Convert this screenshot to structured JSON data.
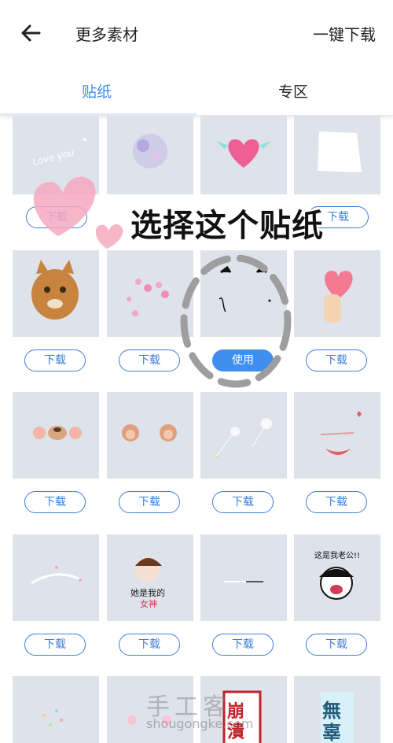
{
  "header": {
    "title": "更多素材",
    "download_all": "一键下载"
  },
  "tabs": [
    {
      "label": "贴纸"
    },
    {
      "label": "专区"
    }
  ],
  "buttons": {
    "download": "下载",
    "use": "使用"
  },
  "stickers": [
    [
      "love-you-text",
      "purple-sparkle",
      "winged-heart",
      "white-paper"
    ],
    [
      "cat-face",
      "pink-hearts",
      "cartoon-face",
      "heart-hand"
    ],
    [
      "bear-blush",
      "bear-ears",
      "dandelion",
      "laughing-mouth"
    ],
    [
      "light-arc",
      "goddess-girl",
      "white-line",
      "meme-guy"
    ],
    [
      "sparkles",
      "pink-glow",
      "collapse-sign",
      "speechless-sign"
    ]
  ],
  "overlay": {
    "instruction": "选择这个贴纸"
  },
  "sticker_text": {
    "love_you": "Love you",
    "goddess": "她是我的\n女神",
    "meme": "这是我老公!!",
    "collapse": "崩潰",
    "speechless": "無辜"
  },
  "watermark": {
    "main": "手工客",
    "sub": "shougongke.com"
  },
  "colors": {
    "accent": "#3f8ef0",
    "thumb_bg": "#dee2ea"
  }
}
